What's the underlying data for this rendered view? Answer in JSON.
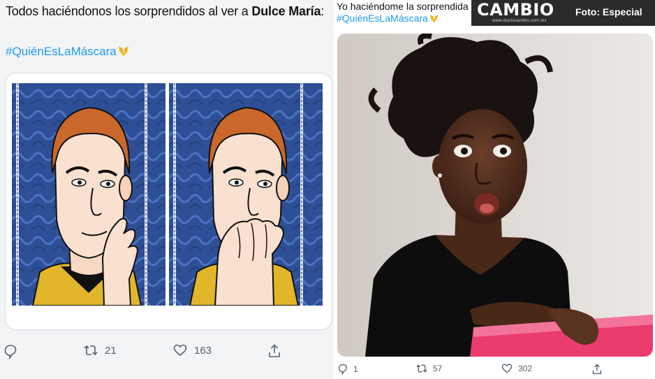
{
  "left_tweet": {
    "text_prefix": "Todos haciéndonos los sorprendidos al ver a ",
    "text_bold": "Dulce María",
    "text_suffix": ":",
    "hashtag": "#QuiénEsLaMáscara",
    "actions": {
      "reply_icon": "speech-bubble-icon",
      "retweet_icon": "retweet-icon",
      "retweets": "21",
      "like_icon": "heart-outline-icon",
      "likes": "163",
      "share_icon": "share-upload-icon"
    }
  },
  "right_tweet": {
    "text": "Yo haciéndome la sorprendida cuando salió Dulce María",
    "hashtag": "#QuiénEsLaMáscara",
    "actions": {
      "replies": "1",
      "retweets": "57",
      "likes": "302"
    }
  },
  "watermark": {
    "logo": "CAMBIO",
    "url": "www.diariocambio.com.mx",
    "credit": "Foto: Especial",
    "background": "#2b2b2b"
  },
  "colors": {
    "link": "#1d9bf0",
    "icon_gray": "#536471",
    "emoji_heart": "#f2b824"
  }
}
